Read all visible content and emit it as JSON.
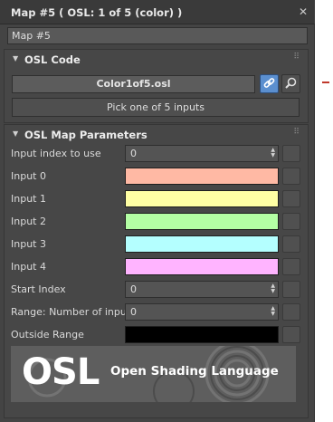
{
  "window": {
    "title": "Map #5  ( OSL: 1 of 5 (color) )",
    "close_glyph": "✕"
  },
  "map_name": "Map #5",
  "osl_code": {
    "header": "OSL Code",
    "file_name": "Color1of5.osl",
    "description": "Pick one of 5 inputs",
    "link_icon": "link-icon",
    "search_icon": "magnifier-icon"
  },
  "osl_params": {
    "header": "OSL Map Parameters",
    "rows": [
      {
        "label": "Input index to use",
        "kind": "spinner",
        "value": "0"
      },
      {
        "label": "Input 0",
        "kind": "color",
        "color": "#ffb9a4"
      },
      {
        "label": "Input 1",
        "kind": "color",
        "color": "#ffffa4"
      },
      {
        "label": "Input 2",
        "kind": "color",
        "color": "#b4ffa4"
      },
      {
        "label": "Input 3",
        "kind": "color",
        "color": "#b4ffff"
      },
      {
        "label": "Input 4",
        "kind": "color",
        "color": "#ffb4ff"
      },
      {
        "label": "Start Index",
        "kind": "spinner",
        "value": "0"
      },
      {
        "label": "Range: Number of inputs",
        "kind": "spinner",
        "value": "0"
      },
      {
        "label": "Outside Range",
        "kind": "color",
        "color": "#000000"
      }
    ]
  },
  "logo": {
    "mark": "OSL",
    "tagline": "Open Shading Language"
  },
  "colors": {
    "panel_bg": "#444444",
    "accent_link": "#5b8fcf"
  }
}
